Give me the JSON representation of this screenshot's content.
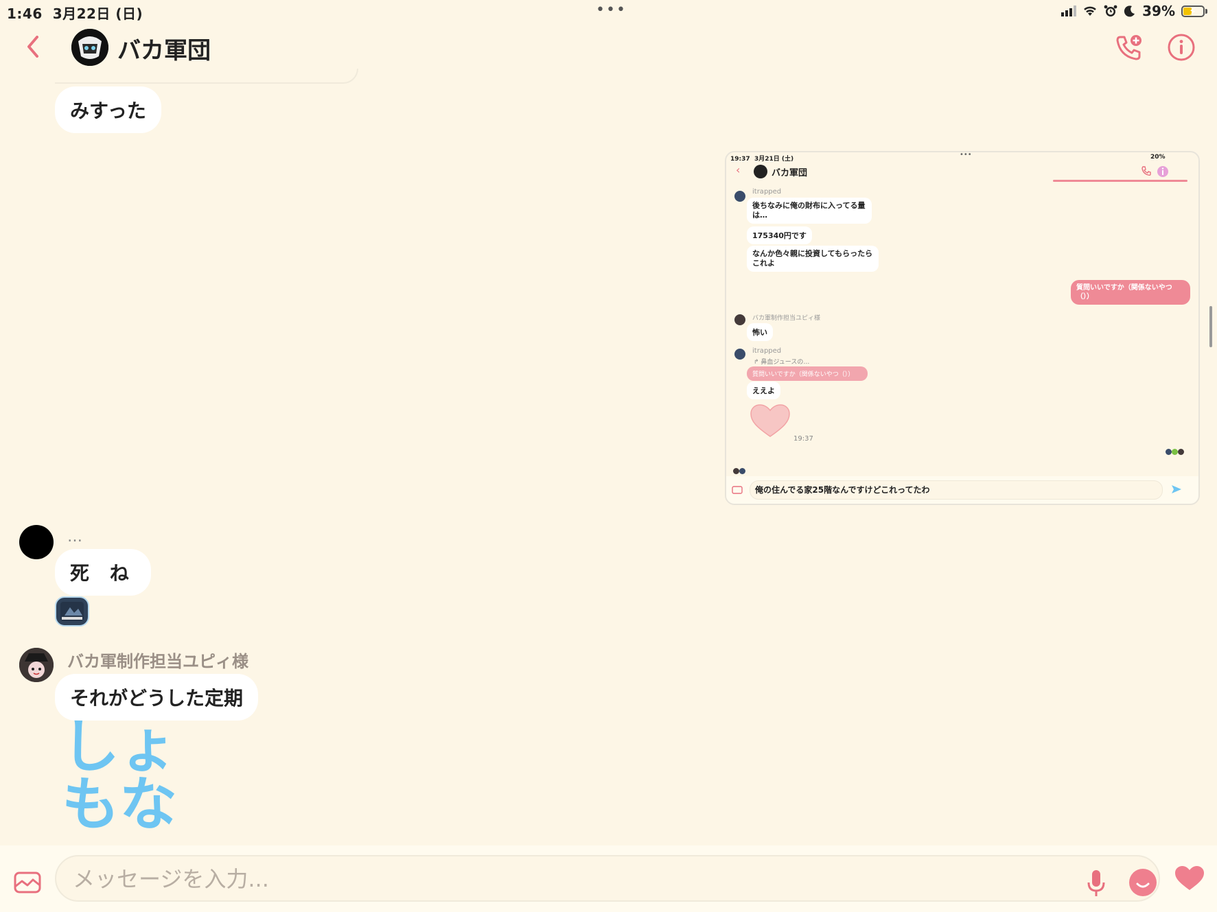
{
  "status": {
    "time": "1:46",
    "date": "3月22日 (日)",
    "dots": "•••",
    "battery": "39%"
  },
  "header": {
    "title": "バカ軍団",
    "back_icon": "chevron-left-icon",
    "call_icon": "phone-plus-icon",
    "info_icon": "info-icon"
  },
  "messages": {
    "misutta": "みすった",
    "sender2_name": "…",
    "shine": "死 ね",
    "sender3_name": "バカ軍制作担当ユピィ様",
    "teiki": "それがどうした定期",
    "big_text": "しょ\nもな"
  },
  "embedded": {
    "time": "19:37",
    "date": "3月21日 (土)",
    "dots": "•••",
    "battery": "20%",
    "title": "バカ軍団",
    "sender1": "itrapped",
    "msg1": "後ちなみに俺の財布に入ってる量は…",
    "msg2": "175340円です",
    "msg3": "なんか色々親に投資してもらったらこれよ",
    "my_msg": "質問いいですか（関係ないやつ（））",
    "sender2": "バカ軍制作担当ユピィ様",
    "msg4": "怖い",
    "sender3": "itrapped",
    "reply_to": "鼻血ジュースの…",
    "quoted": "質問いいですか（関係ないやつ（））",
    "msg5": "ええよ",
    "heart_time": "19:37",
    "input_text": "俺の住んでる家25階なんですけどこれってたわ"
  },
  "input": {
    "placeholder": "メッセージを入力..."
  },
  "colors": {
    "accent": "#e8707e",
    "bg": "#fdf6e6",
    "big_text": "#6ec5f2",
    "my_bubble": "#ef8a96"
  }
}
